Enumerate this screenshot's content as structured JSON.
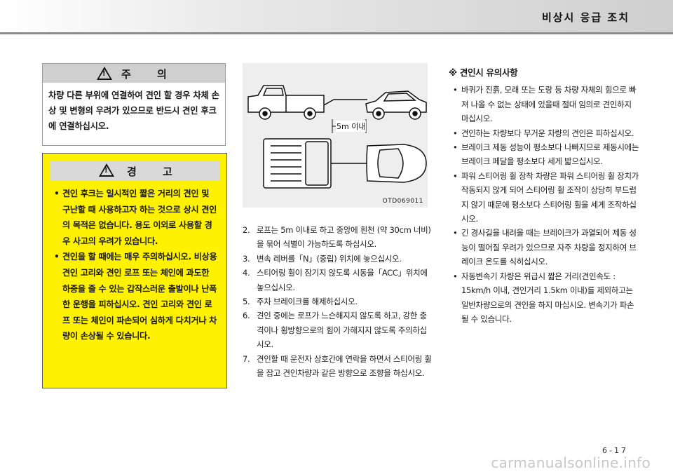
{
  "header": {
    "title": "비상시 응급 조치"
  },
  "caution": {
    "title": "주 의",
    "mark": "!",
    "text": "차량 다른 부위에 연결하여 견인 할 경우 차체 손상 및 변형의 우려가 있으므로 반드시 견인 후크에 연결하십시오."
  },
  "warning": {
    "title": "경 고",
    "mark": "!",
    "items": [
      "견인 후크는 일시적인 짧은 거리의 견인 및 구난할 때 사용하고자 하는 것으로 상시 견인의 목적은 없습니다. 용도 이외로 사용할 경우 사고의 우려가 있습니다.",
      "견인을 할 때에는 매우 주의하십시오. 비상용 견인 고리와 견인 로프 또는 체인에 과도한 하중을 줄 수 있는 갑작스러운 출발이나 난폭한 운행을 피하십시오. 견인 고리와 견인 로프 또는 체인이 파손되어 심하게 다치거나 차량이 손상될 수 있습니다."
    ]
  },
  "figure": {
    "distance_label": "5m 이내",
    "code": "OTD069011"
  },
  "steps": [
    {
      "num": "2.",
      "text": "로프는 5m 이내로 하고 중앙에 흰천 (약 30cm 너비)을 묶어 식별이 가능하도록 하십시오."
    },
    {
      "num": "3.",
      "text": "변속 레버를「N」(중립) 위치에 놓으십시오."
    },
    {
      "num": "4.",
      "text": "스티어링 휠이 잠기지 않도록 시동을「ACC」위치에 놓으십시오."
    },
    {
      "num": "5.",
      "text": "주차 브레이크를 해제하십시오."
    },
    {
      "num": "6.",
      "text": "견인 중에는 로프가 느슨해지지 않도록 하고, 강한 충격이나 횡방향으로의 힘이 가해지지 않도록 주의하십시오."
    },
    {
      "num": "7.",
      "text": "견인할 때 운전자 상호간에 연락을 하면서 스티어링 휠을 잡고 견인차량과 같은 방향으로 조향을 하십시오."
    }
  ],
  "notes": {
    "title": "※ 견인시 유의사항",
    "items": [
      "바퀴가 진흙, 모래 또는 도랑 등 차량 자체의 힘으로 빠져 나올 수 없는 상태에 있을때 절대 임의로 견인하지 마십시오.",
      "견인하는 차량보다 무거운 차량의 견인은 피하십시오.",
      "브레이크 제동 성능이 평소보다 나빠지므로 제동시에는 브레이크 페달을 평소보다 세게 밟으십시오.",
      "파워 스티어링 휠 장착 차량은 파워 스티어링 휠 장치가 작동되지 않게 되어 스티어링 휠 조작이 상당히 부드럽지 않기 때문에 평소보다 스티어링 휠을 세게 조작하십시오.",
      "긴 경사길을 내려올 때는 브레이크가 과열되어 제동 성능이 떨어질 우려가 있으므로 자주 차량을 정지하여 브레이크 온도를 식히십시오.",
      "자동변속기 차량은 위급시 짧은 거리(견인속도 : 15km/h 이내, 견인거리 1.5km 이내)를 제외하고는 일반차량으로의 견인을 하지 마십시오. 변속기가 파손될 수 있습니다."
    ]
  },
  "page_number": "6-17",
  "watermark": "carmanualsonline.info"
}
